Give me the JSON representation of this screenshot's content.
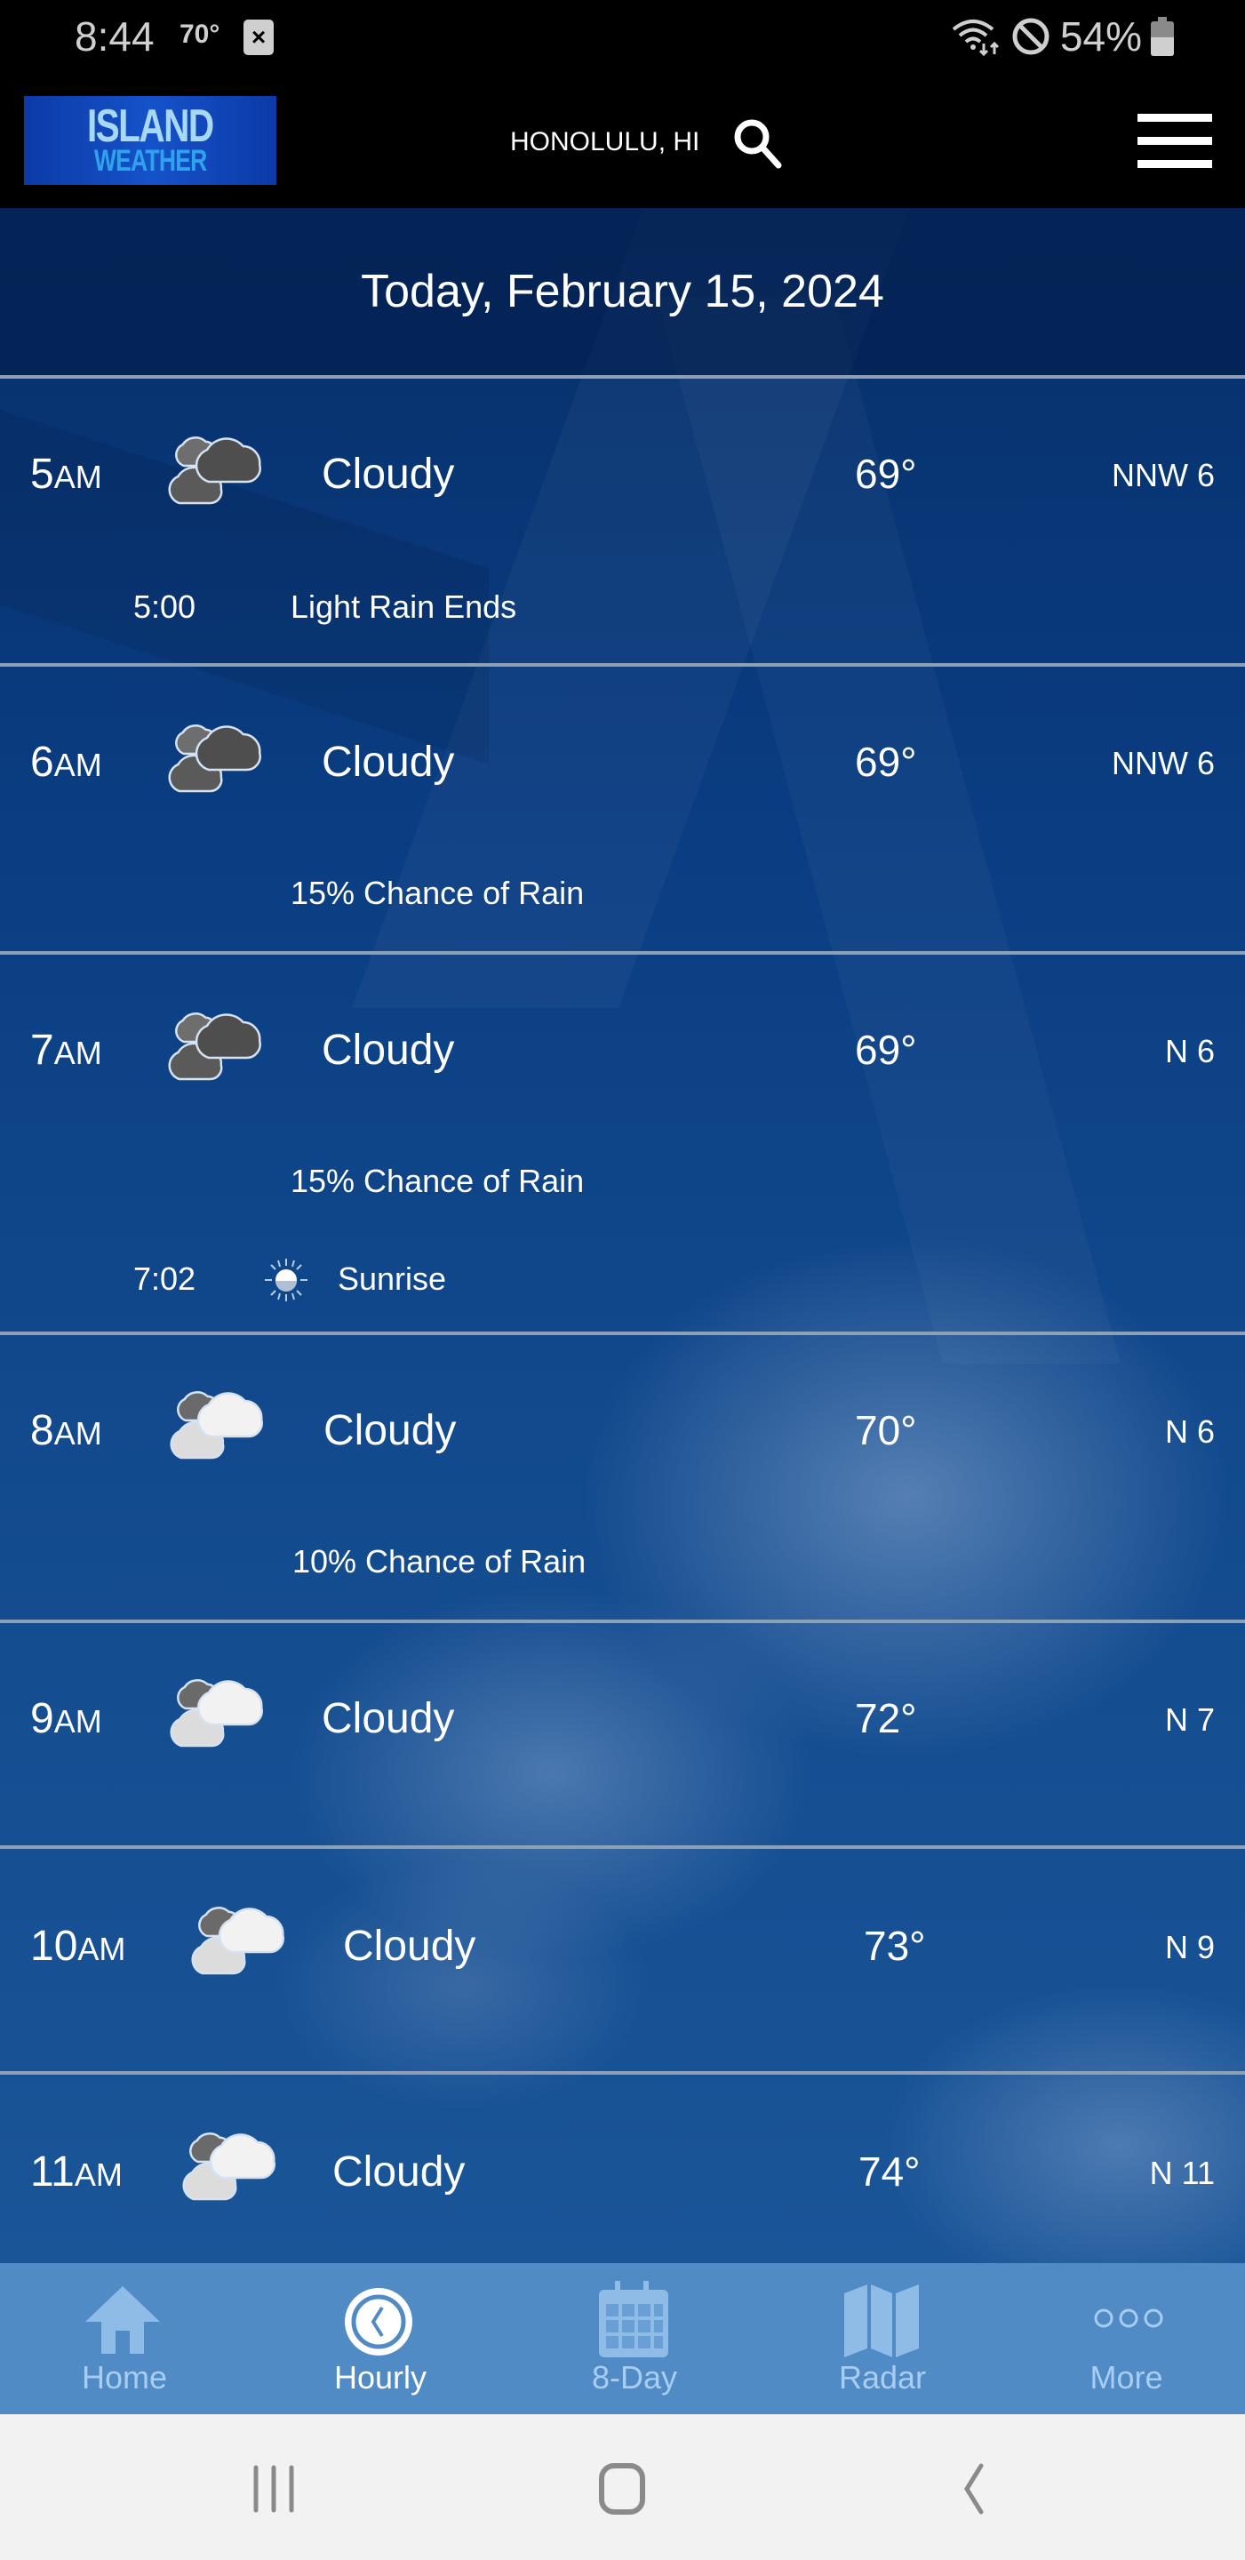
{
  "status_bar": {
    "time": "8:44",
    "temperature": "70°",
    "notification_icon": "close-box-icon",
    "battery_percent": "54%",
    "battery_level": 0.54,
    "icons": [
      "wifi-icon",
      "do-not-disturb-icon",
      "battery-icon"
    ]
  },
  "header": {
    "logo_line1": "ISLAND",
    "logo_line2": "WEATHER",
    "location": "HONOLULU, HI",
    "search_icon": "search-icon",
    "menu_icon": "hamburger-menu-icon"
  },
  "date_header": "Today, February 15, 2024",
  "hours": [
    {
      "hour": "5",
      "period": "AM",
      "icon": "cloudy-dark-icon",
      "condition": "Cloudy",
      "temp": "69°",
      "wind": "NNW 6",
      "events": [
        {
          "time": "5:00",
          "label": "Light Rain Ends"
        }
      ]
    },
    {
      "hour": "6",
      "period": "AM",
      "icon": "cloudy-dark-icon",
      "condition": "Cloudy",
      "temp": "69°",
      "wind": "NNW 6",
      "detail": "15% Chance of Rain"
    },
    {
      "hour": "7",
      "period": "AM",
      "icon": "cloudy-dark-icon",
      "condition": "Cloudy",
      "temp": "69°",
      "wind": "N 6",
      "detail": "15% Chance of Rain",
      "events": [
        {
          "time": "7:02",
          "icon": "sunrise-icon",
          "label": "Sunrise"
        }
      ]
    },
    {
      "hour": "8",
      "period": "AM",
      "icon": "cloudy-light-icon",
      "condition": "Cloudy",
      "temp": "70°",
      "wind": "N 6",
      "detail": "10% Chance of Rain"
    },
    {
      "hour": "9",
      "period": "AM",
      "icon": "cloudy-light-icon",
      "condition": "Cloudy",
      "temp": "72°",
      "wind": "N 7"
    },
    {
      "hour": "10",
      "period": "AM",
      "icon": "cloudy-light-icon",
      "condition": "Cloudy",
      "temp": "73°",
      "wind": "N 9"
    },
    {
      "hour": "11",
      "period": "AM",
      "icon": "cloudy-light-icon",
      "condition": "Cloudy",
      "temp": "74°",
      "wind": "N 11"
    }
  ],
  "tabs": [
    {
      "label": "Home",
      "icon": "home-icon",
      "active": false
    },
    {
      "label": "Hourly",
      "icon": "clock-icon",
      "active": true
    },
    {
      "label": "8-Day",
      "icon": "calendar-icon",
      "active": false
    },
    {
      "label": "Radar",
      "icon": "map-icon",
      "active": false
    },
    {
      "label": "More",
      "icon": "more-dots-icon",
      "active": false
    }
  ],
  "nav_bar": [
    "recent-apps-icon",
    "home-button-icon",
    "back-icon"
  ],
  "colors": {
    "tab_bar": "#508bc6",
    "tab_inactive": "#a8cdf0",
    "tab_active": "#ffffff",
    "divider": "#8ea0b6",
    "background_blue": "#0a3d82"
  }
}
